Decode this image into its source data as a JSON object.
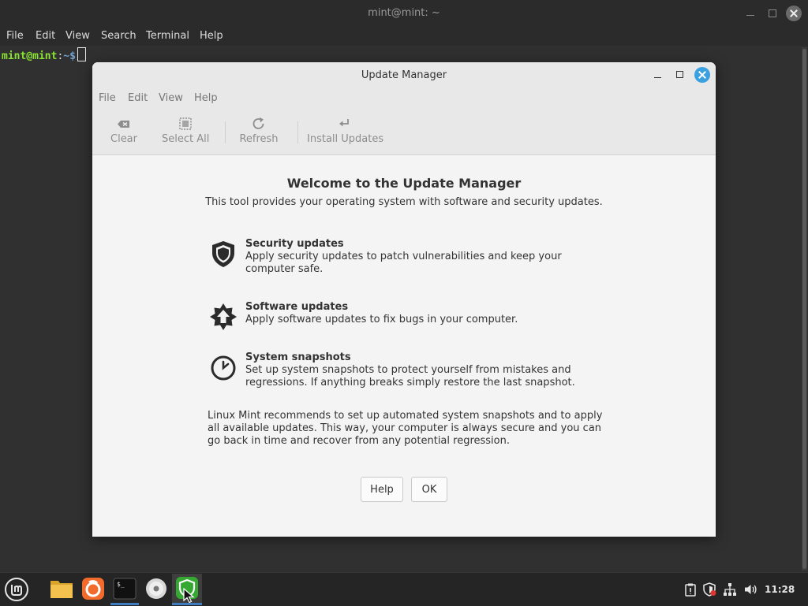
{
  "terminal": {
    "title": "mint@mint: ~",
    "menu": [
      "File",
      "Edit",
      "View",
      "Search",
      "Terminal",
      "Help"
    ],
    "prompt_user": "mint@mint",
    "prompt_sep": ":",
    "prompt_path": "~$"
  },
  "update_manager": {
    "title": "Update Manager",
    "menu": [
      "File",
      "Edit",
      "View",
      "Help"
    ],
    "toolbar": {
      "clear": "Clear",
      "select_all": "Select All",
      "refresh": "Refresh",
      "install_updates": "Install Updates"
    },
    "welcome": {
      "title": "Welcome to the Update Manager",
      "subtitle": "This tool provides your operating system with software and security updates.",
      "features": [
        {
          "icon": "shield-icon",
          "title": "Security updates",
          "description": "Apply security updates to patch vulnerabilities and keep your computer safe."
        },
        {
          "icon": "star-upload-icon",
          "title": "Software updates",
          "description": "Apply software updates to fix bugs in your computer."
        },
        {
          "icon": "clock-icon",
          "title": "System snapshots",
          "description": "Set up system snapshots to protect yourself from mistakes and regressions. If anything breaks simply restore the last snapshot."
        }
      ],
      "recommendation": "Linux Mint recommends to set up automated system snapshots and to apply all available updates. This way, your computer is always secure and you can go back in time and recover from any potential regression.",
      "help_button": "Help",
      "ok_button": "OK"
    }
  },
  "taskbar": {
    "apps": [
      "menu-icon",
      "files-icon",
      "firefox-icon",
      "terminal-icon",
      "disc-icon",
      "update-manager-icon"
    ],
    "tray": [
      "clipboard-icon",
      "shield-tray-icon",
      "network-icon",
      "volume-icon"
    ],
    "time": "11:28"
  },
  "colors": {
    "close_blue": "#3ba0e0",
    "prompt_green": "#8ae234",
    "prompt_blue": "#729fcf",
    "mint_green": "#35a831"
  }
}
